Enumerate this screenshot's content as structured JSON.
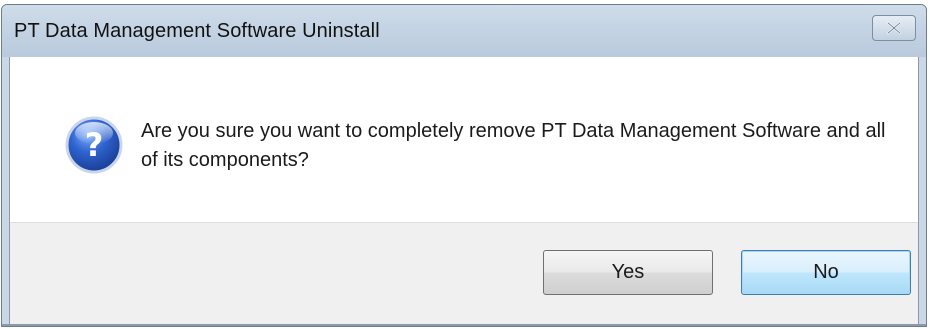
{
  "dialog": {
    "title": "PT Data Management Software Uninstall",
    "message": "Are you sure you want to completely remove PT Data Management Software and all of its components?",
    "icon": "question-icon",
    "buttons": {
      "yes_label": "Yes",
      "no_label": "No"
    },
    "close_icon": "close-icon"
  },
  "colors": {
    "titlebar": "#c2d2e3",
    "button_bar": "#f0f0f0",
    "icon_blue": "#2a58b8",
    "focused_button_border": "#3c7fb1"
  }
}
